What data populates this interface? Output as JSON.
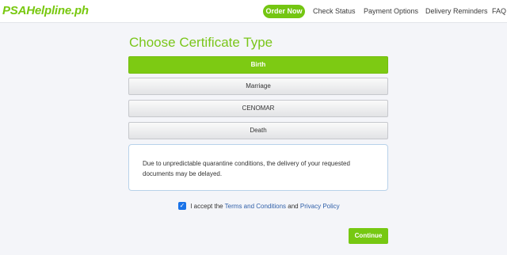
{
  "brand": {
    "logo_text": "PSAHelpline.ph"
  },
  "nav": {
    "order_now": "Order Now",
    "check_status": "Check Status",
    "payment_options": "Payment Options",
    "delivery_reminders": "Delivery Reminders",
    "faq": "FAQ"
  },
  "main": {
    "title": "Choose Certificate Type",
    "options": [
      {
        "label": "Birth",
        "selected": true
      },
      {
        "label": "Marriage",
        "selected": false
      },
      {
        "label": "CENOMAR",
        "selected": false
      },
      {
        "label": "Death",
        "selected": false
      }
    ],
    "notice": "Due to unpredictable quarantine conditions, the delivery of your requested documents may be delayed.",
    "accept": {
      "checked": true,
      "prefix": "I accept the",
      "terms_link": "Terms and Conditions",
      "and_text": "and",
      "privacy_link": "Privacy Policy"
    },
    "continue_label": "Continue"
  },
  "colors": {
    "brand_green": "#78c80f",
    "link_blue": "#2f5fa8",
    "notice_border": "#b8d2ea"
  }
}
